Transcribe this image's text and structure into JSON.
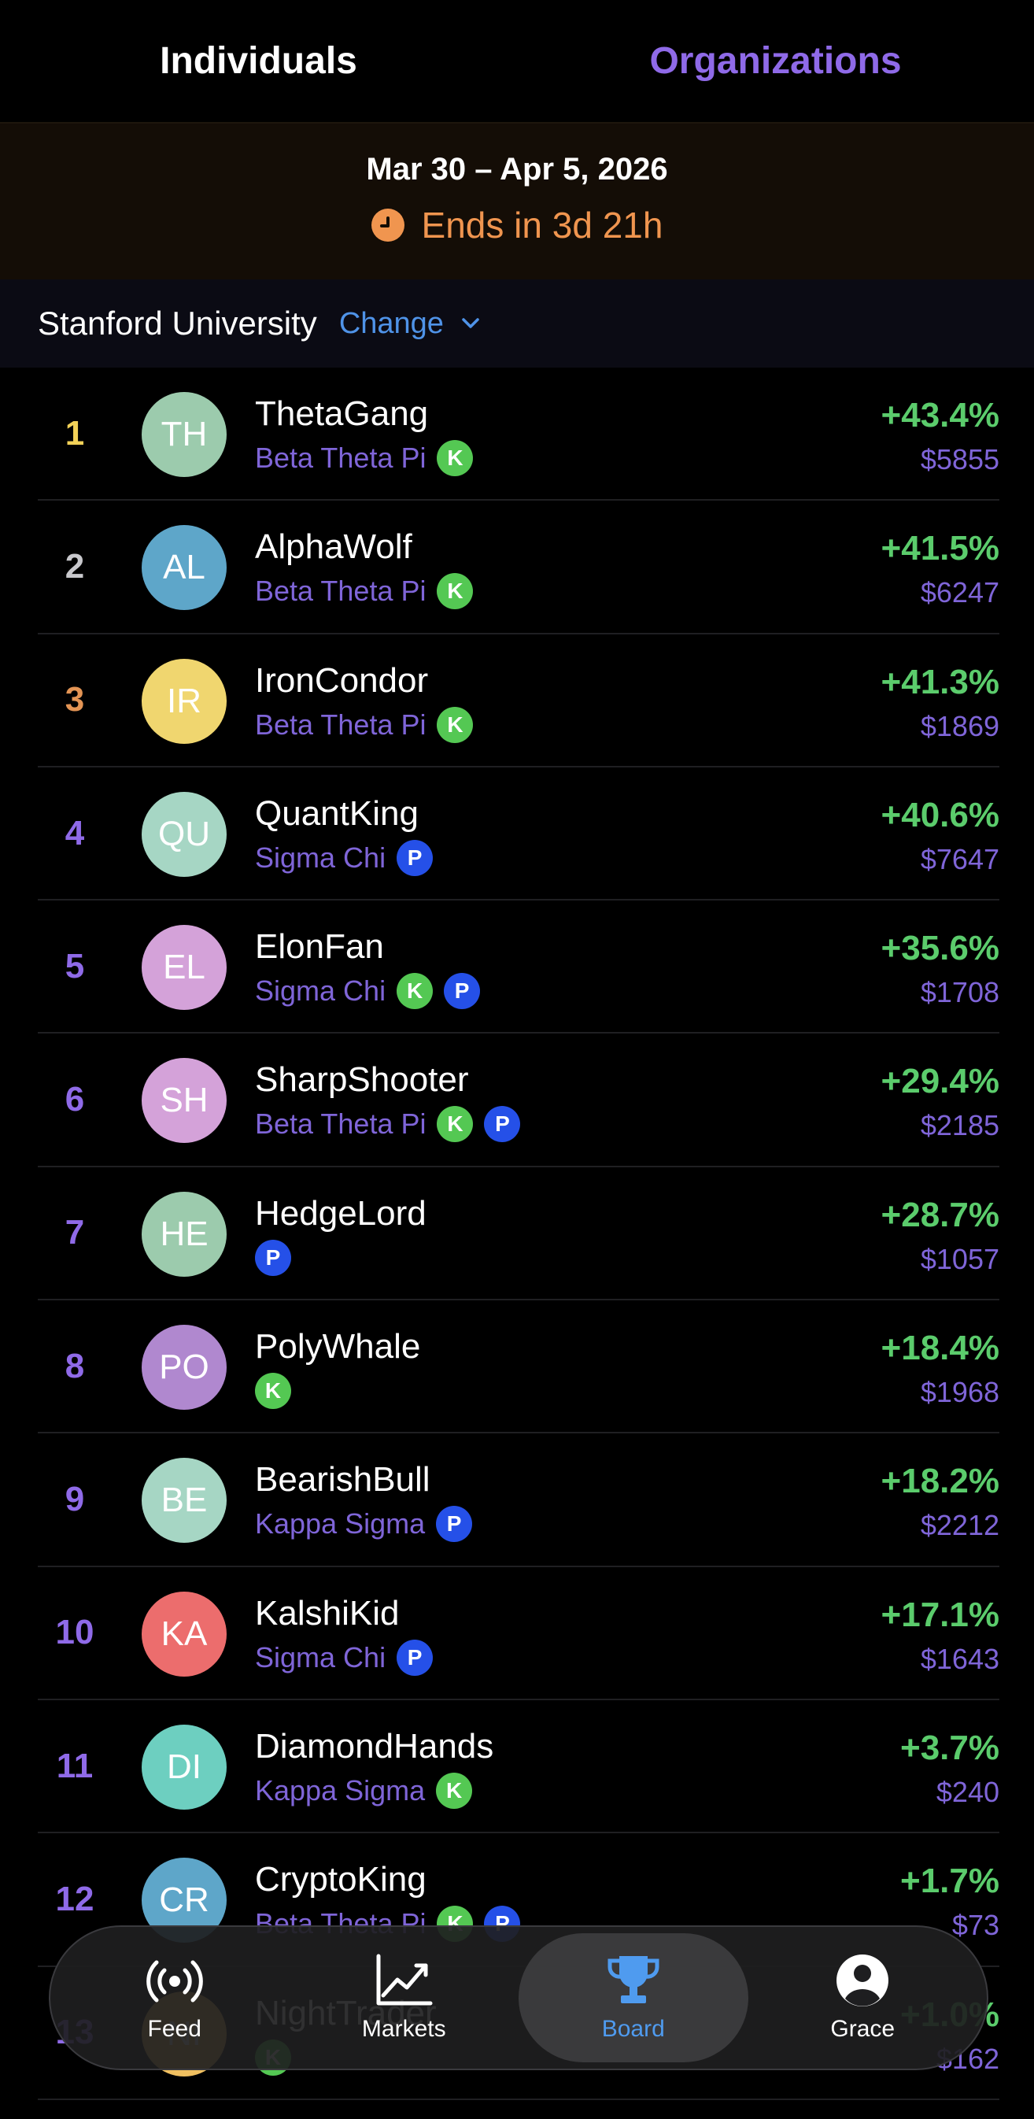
{
  "tabs": {
    "individuals": "Individuals",
    "organizations": "Organizations"
  },
  "week": {
    "range": "Mar 30 – Apr 5, 2026",
    "ends": "Ends in 3d 21h"
  },
  "org_selector": {
    "name": "Stanford University",
    "change": "Change"
  },
  "colors": {
    "rank1": "#f2d158",
    "rank2": "#c8c8cc",
    "rank3": "#e39454",
    "rank_other": "#8f6ae8",
    "gain": "#5bcc6c",
    "org": "#7f65d8",
    "accent": "#4f9bef"
  },
  "rows": [
    {
      "rank": "1",
      "initials": "TH",
      "name": "ThetaGang",
      "org": "Beta Theta Pi",
      "badges": [
        "K"
      ],
      "pct": "+43.4%",
      "amount": "$5855",
      "avatar": "#9ccbad"
    },
    {
      "rank": "2",
      "initials": "AL",
      "name": "AlphaWolf",
      "org": "Beta Theta Pi",
      "badges": [
        "K"
      ],
      "pct": "+41.5%",
      "amount": "$6247",
      "avatar": "#5ea6c9"
    },
    {
      "rank": "3",
      "initials": "IR",
      "name": "IronCondor",
      "org": "Beta Theta Pi",
      "badges": [
        "K"
      ],
      "pct": "+41.3%",
      "amount": "$1869",
      "avatar": "#f0d66f"
    },
    {
      "rank": "4",
      "initials": "QU",
      "name": "QuantKing",
      "org": "Sigma Chi",
      "badges": [
        "P"
      ],
      "pct": "+40.6%",
      "amount": "$7647",
      "avatar": "#a6d6c4"
    },
    {
      "rank": "5",
      "initials": "EL",
      "name": "ElonFan",
      "org": "Sigma Chi",
      "badges": [
        "K",
        "P"
      ],
      "pct": "+35.6%",
      "amount": "$1708",
      "avatar": "#d4a2d9"
    },
    {
      "rank": "6",
      "initials": "SH",
      "name": "SharpShooter",
      "org": "Beta Theta Pi",
      "badges": [
        "K",
        "P"
      ],
      "pct": "+29.4%",
      "amount": "$2185",
      "avatar": "#d4a2d9"
    },
    {
      "rank": "7",
      "initials": "HE",
      "name": "HedgeLord",
      "org": "",
      "badges": [
        "P"
      ],
      "pct": "+28.7%",
      "amount": "$1057",
      "avatar": "#9ccbad"
    },
    {
      "rank": "8",
      "initials": "PO",
      "name": "PolyWhale",
      "org": "",
      "badges": [
        "K"
      ],
      "pct": "+18.4%",
      "amount": "$1968",
      "avatar": "#b088cf"
    },
    {
      "rank": "9",
      "initials": "BE",
      "name": "BearishBull",
      "org": "Kappa Sigma",
      "badges": [
        "P"
      ],
      "pct": "+18.2%",
      "amount": "$2212",
      "avatar": "#a6d6c4"
    },
    {
      "rank": "10",
      "initials": "KA",
      "name": "KalshiKid",
      "org": "Sigma Chi",
      "badges": [
        "P"
      ],
      "pct": "+17.1%",
      "amount": "$1643",
      "avatar": "#ec6d6d"
    },
    {
      "rank": "11",
      "initials": "DI",
      "name": "DiamondHands",
      "org": "Kappa Sigma",
      "badges": [
        "K"
      ],
      "pct": "+3.7%",
      "amount": "$240",
      "avatar": "#6dcfc0"
    },
    {
      "rank": "12",
      "initials": "CR",
      "name": "CryptoKing",
      "org": "Beta Theta Pi",
      "badges": [
        "K",
        "P"
      ],
      "pct": "+1.7%",
      "amount": "$73",
      "avatar": "#5ea6c9"
    },
    {
      "rank": "13",
      "initials": "NI",
      "name": "NightTrader",
      "org": "",
      "badges": [
        "K"
      ],
      "pct": "+1.0%",
      "amount": "$162",
      "avatar": "#f0c060"
    }
  ],
  "nav": {
    "feed": {
      "label": "Feed",
      "icon": "broadcast-icon"
    },
    "markets": {
      "label": "Markets",
      "icon": "chart-line-icon"
    },
    "board": {
      "label": "Board",
      "icon": "trophy-icon"
    },
    "profile": {
      "label": "Grace",
      "icon": "person-icon"
    }
  }
}
